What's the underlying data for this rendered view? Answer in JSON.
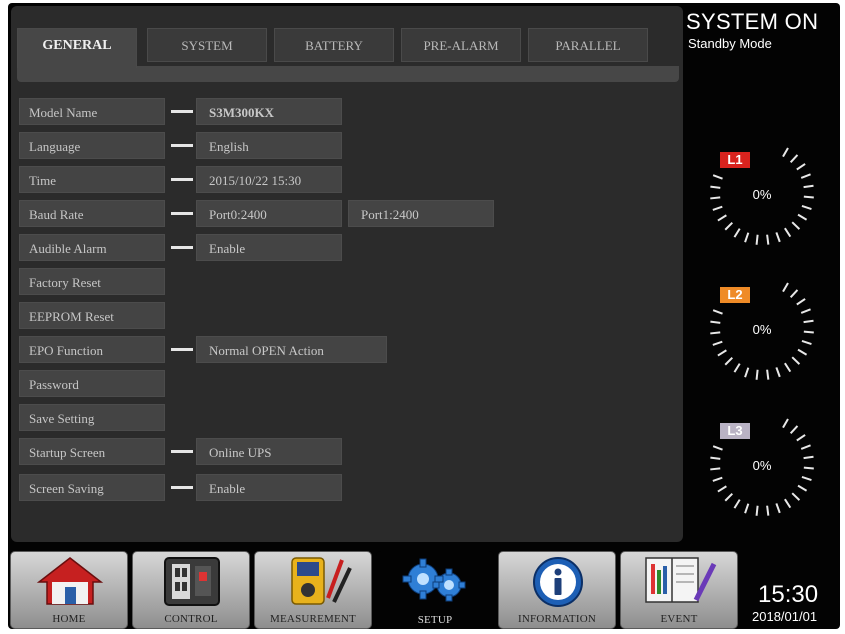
{
  "tabs": [
    {
      "label": "GENERAL",
      "active": true
    },
    {
      "label": "SYSTEM",
      "active": false
    },
    {
      "label": "BATTERY",
      "active": false
    },
    {
      "label": "PRE-ALARM",
      "active": false
    },
    {
      "label": "PARALLEL",
      "active": false
    }
  ],
  "settings": [
    {
      "label": "Model Name",
      "values": [
        "S3M300KX"
      ]
    },
    {
      "label": "Language",
      "values": [
        "English"
      ]
    },
    {
      "label": "Time",
      "values": [
        "2015/10/22 15:30"
      ]
    },
    {
      "label": "Baud Rate",
      "values": [
        "Port0:2400",
        "Port1:2400"
      ]
    },
    {
      "label": "Audible Alarm",
      "values": [
        "Enable"
      ]
    },
    {
      "label": "Factory Reset",
      "values": []
    },
    {
      "label": "EEPROM Reset",
      "values": []
    },
    {
      "label": "EPO Function",
      "values": [
        "Normal OPEN Action"
      ]
    },
    {
      "label": "Password",
      "values": []
    },
    {
      "label": "Save Setting",
      "values": []
    },
    {
      "label": "Startup Screen",
      "values": [
        "Online UPS"
      ]
    },
    {
      "label": "Screen Saving",
      "values": [
        "Enable"
      ]
    }
  ],
  "status": {
    "title": "SYSTEM ON",
    "mode": "Standby Mode"
  },
  "gauges": [
    {
      "label": "L1",
      "value": "0%",
      "label_color": "#d8231e"
    },
    {
      "label": "L2",
      "value": "0%",
      "label_color": "#ef8b27"
    },
    {
      "label": "L3",
      "value": "0%",
      "label_color": "#b9b2c4"
    }
  ],
  "nav": [
    {
      "label": "HOME",
      "icon": "home-icon"
    },
    {
      "label": "CONTROL",
      "icon": "control-panel-icon"
    },
    {
      "label": "MEASUREMENT",
      "icon": "multimeter-icon"
    },
    {
      "label": "SETUP",
      "icon": "gears-icon"
    },
    {
      "label": "INFORMATION",
      "icon": "info-icon"
    },
    {
      "label": "EVENT",
      "icon": "event-log-icon"
    }
  ],
  "clock": {
    "time": "15:30",
    "date": "2018/01/01"
  }
}
